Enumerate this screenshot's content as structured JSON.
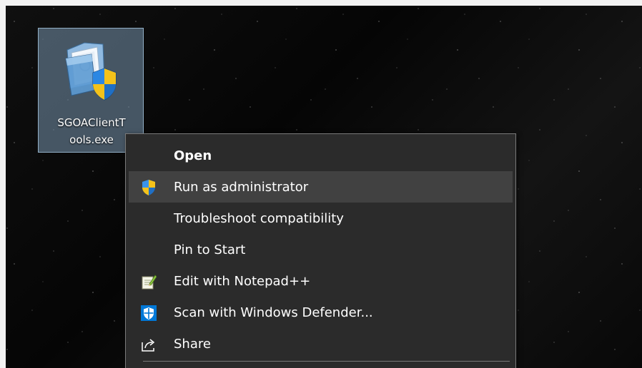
{
  "desktop": {
    "icon": {
      "name": "shield-exe-icon",
      "label_line1": "SGOAClientT",
      "label_line2": "ools.exe"
    }
  },
  "context_menu": {
    "items": [
      {
        "label": "Open",
        "icon": "",
        "bold": true
      },
      {
        "label": "Run as administrator",
        "icon": "uac-shield-icon",
        "hover": true
      },
      {
        "label": "Troubleshoot compatibility",
        "icon": ""
      },
      {
        "label": "Pin to Start",
        "icon": ""
      },
      {
        "label": "Edit with Notepad++",
        "icon": "notepad-plus-plus-icon"
      },
      {
        "label": "Scan with Windows Defender...",
        "icon": "windows-defender-icon"
      },
      {
        "label": "Share",
        "icon": "share-icon"
      }
    ]
  },
  "colors": {
    "menu_background": "#2b2b2b",
    "menu_hover": "#414141",
    "menu_border": "#7a7a7a",
    "selection_background": "#78a0b4",
    "shield_blue": "#1f6fc5",
    "shield_yellow": "#f4c21a",
    "defender_blue": "#0078d7"
  }
}
